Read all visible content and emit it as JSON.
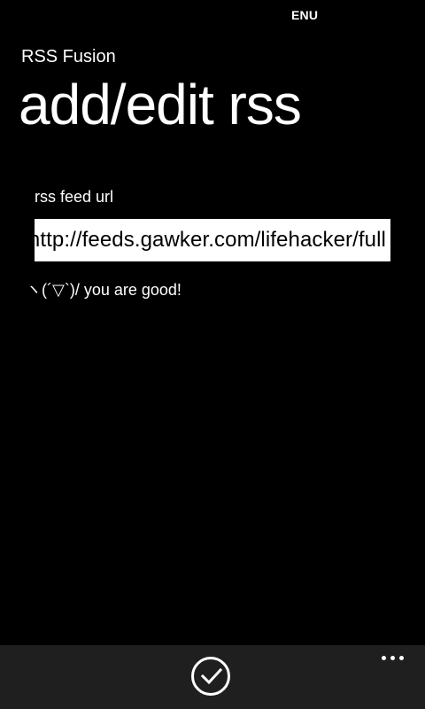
{
  "status_bar": {
    "language": "ENU"
  },
  "app": {
    "title": "RSS Fusion",
    "page_title": "add/edit rss"
  },
  "form": {
    "label": "rss feed url",
    "url_value": "http://feeds.gawker.com/lifehacker/full",
    "validation_message": "ヽ(´▽`)/ you are good!"
  },
  "app_bar": {
    "primary_icon": "checkmark-circle-icon",
    "menu_icon": "ellipsis-icon"
  },
  "colors": {
    "background": "#000000",
    "foreground": "#ffffff",
    "app_bar": "#1f1f1f"
  }
}
